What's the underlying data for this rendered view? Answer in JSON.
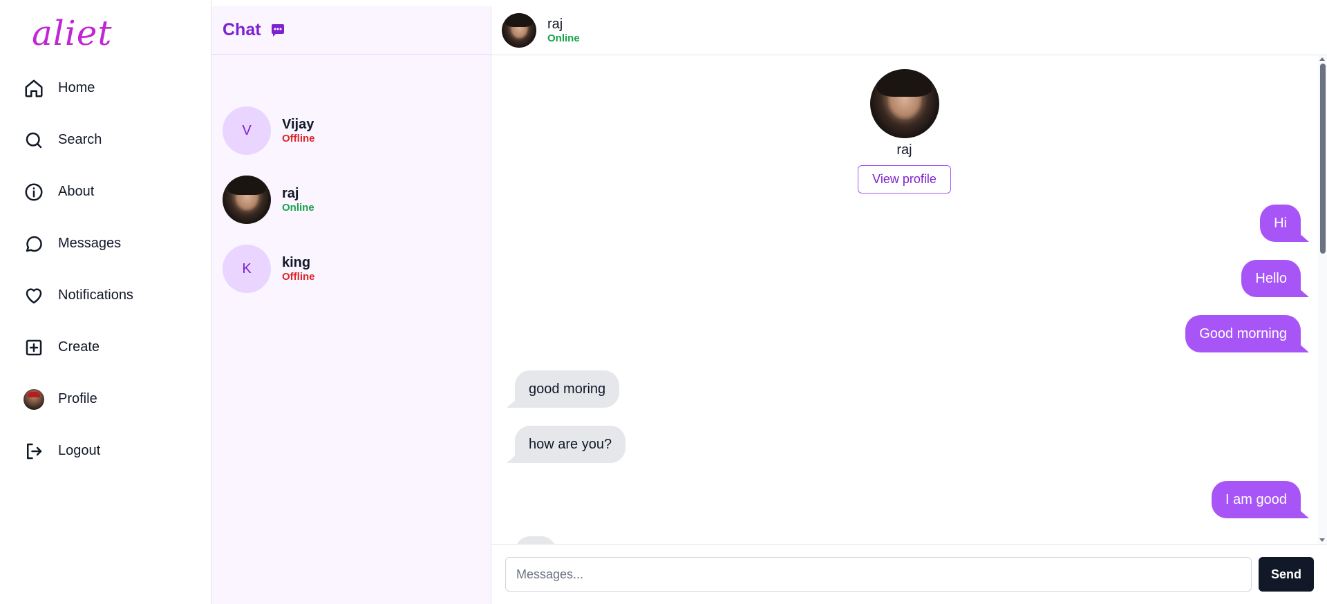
{
  "app": {
    "logo": "aliet"
  },
  "sidebar": {
    "items": [
      {
        "label": "Home",
        "icon": "home-icon"
      },
      {
        "label": "Search",
        "icon": "search-icon"
      },
      {
        "label": "About",
        "icon": "info-icon"
      },
      {
        "label": "Messages",
        "icon": "message-circle-icon"
      },
      {
        "label": "Notifications",
        "icon": "heart-icon"
      },
      {
        "label": "Create",
        "icon": "plus-square-icon"
      },
      {
        "label": "Profile",
        "icon": "avatar"
      },
      {
        "label": "Logout",
        "icon": "logout-icon"
      }
    ]
  },
  "chatlist": {
    "title": "Chat",
    "icon": "chat-bubble-icon",
    "contacts": [
      {
        "name": "Vijay",
        "initial": "V",
        "status": "Offline"
      },
      {
        "name": "raj",
        "initial": "",
        "status": "Online"
      },
      {
        "name": "king",
        "initial": "K",
        "status": "Offline"
      }
    ]
  },
  "chat": {
    "header": {
      "name": "raj",
      "status": "Online"
    },
    "profile": {
      "name": "raj",
      "button": "View profile"
    },
    "messages": [
      {
        "text": "Hi",
        "direction": "outgoing"
      },
      {
        "text": "Hello",
        "direction": "outgoing"
      },
      {
        "text": "Good morning",
        "direction": "outgoing"
      },
      {
        "text": "good moring",
        "direction": "incoming"
      },
      {
        "text": "how are you?",
        "direction": "incoming"
      },
      {
        "text": "I am good",
        "direction": "outgoing"
      }
    ],
    "composer": {
      "placeholder": "Messages...",
      "send_label": "Send"
    }
  },
  "colors": {
    "brand": "#c026d3",
    "accent": "#7e22ce",
    "outgoing_bubble": "#a855f7",
    "incoming_bubble": "#e5e7eb",
    "online": "#16a34a",
    "offline": "#dc2626"
  }
}
